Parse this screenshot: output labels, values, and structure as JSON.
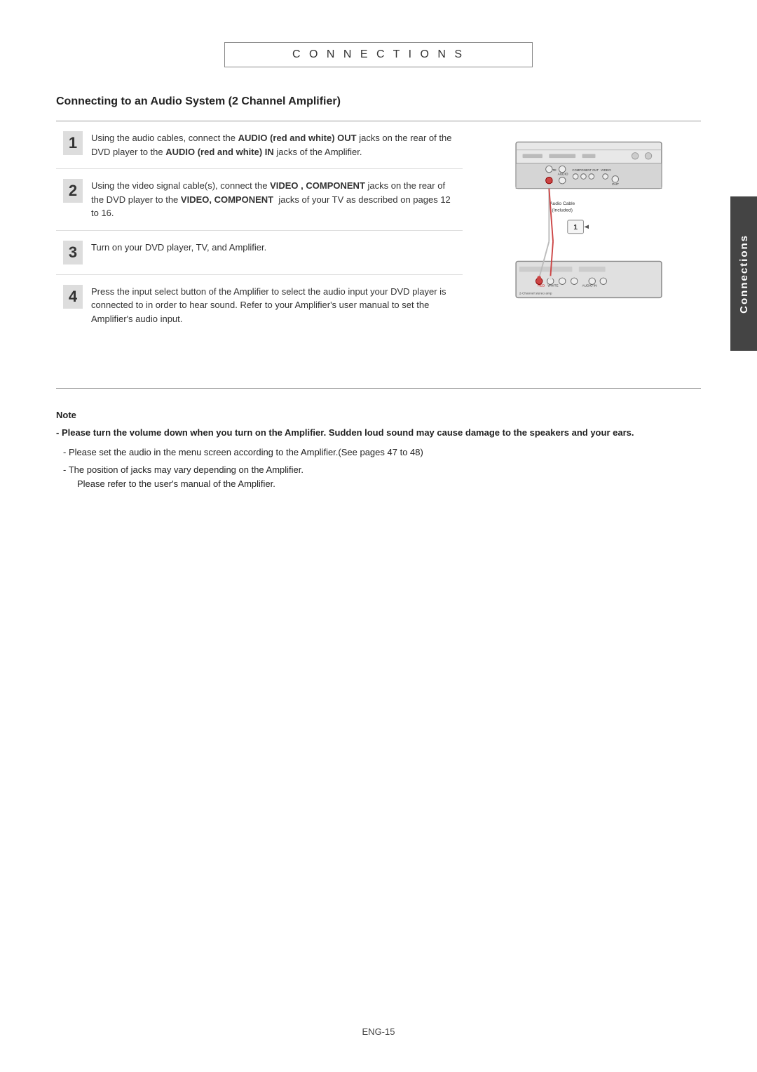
{
  "header": {
    "title": "C O N N E C T I O N S"
  },
  "side_tab": {
    "label": "Connections"
  },
  "section": {
    "title": "Connecting to an Audio System (2 Channel Amplifier)"
  },
  "steps": [
    {
      "number": "1",
      "text_parts": [
        {
          "text": "Using the audio cables, connect the ",
          "bold": false
        },
        {
          "text": "AUDIO (red and white)",
          "bold": true
        },
        {
          "text": " OUT jacks on the rear of the DVD player to the ",
          "bold": false
        },
        {
          "text": "AUDIO (red and white) IN",
          "bold": true
        },
        {
          "text": " jacks of the Amplifier.",
          "bold": false
        }
      ]
    },
    {
      "number": "2",
      "text_parts": [
        {
          "text": "Using the video signal cable(s), connect the ",
          "bold": false
        },
        {
          "text": "VIDEO , COMPONENT",
          "bold": true
        },
        {
          "text": " jacks on the rear of the DVD player to the ",
          "bold": false
        },
        {
          "text": "VIDEO, COMPONENT",
          "bold": true
        },
        {
          "text": "  jacks of your TV as described on pages 12 to 16.",
          "bold": false
        }
      ]
    },
    {
      "number": "3",
      "text": "Turn on your DVD player, TV, and Amplifier."
    },
    {
      "number": "4",
      "text_parts": [
        {
          "text": "Press the input select button of the Amplifier to select the audio input your DVD player is connected to in order to hear sound. Refer to your Amplifier's user manual to set the Amplifier's audio input.",
          "bold": false
        }
      ]
    }
  ],
  "notes": {
    "label": "Note",
    "bold_note": "Please turn the volume down when you turn on the Amplifier. Sudden loud sound may cause damage to the speakers and your ears.",
    "items": [
      "Please set the audio in the menu screen according to the Amplifier.(See pages 47 to 48)",
      "The position of jacks may vary depending on the Amplifier.\n    Please refer to the user's manual of the Amplifier."
    ]
  },
  "footer": {
    "page": "ENG-15"
  }
}
